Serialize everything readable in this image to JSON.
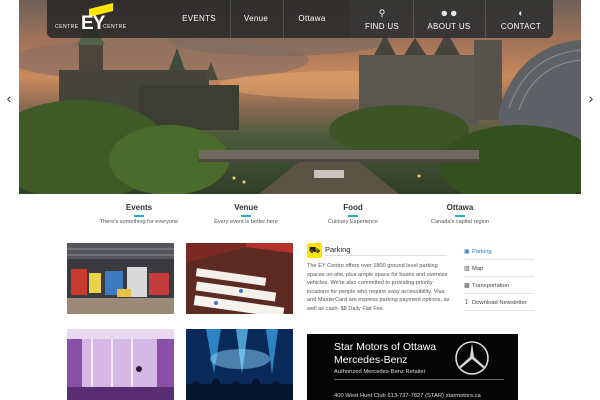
{
  "logo": {
    "brand": "EY",
    "left_word": "CENTRE",
    "right_word": "CENTRE"
  },
  "nav": {
    "links": [
      "EVENTS",
      "Venue",
      "Ottawa"
    ],
    "icon_links": [
      {
        "label": "FIND US",
        "icon": "map-pin-icon"
      },
      {
        "label": "ABOUT US",
        "icon": "people-icon"
      },
      {
        "label": "CONTACT",
        "icon": "contact-icon"
      }
    ]
  },
  "hero": {
    "prev": "‹",
    "next": "›"
  },
  "categories": [
    {
      "title": "Events",
      "subtitle": "There's something for everyone"
    },
    {
      "title": "Venue",
      "subtitle": "Every event is better here"
    },
    {
      "title": "Food",
      "subtitle": "Culinary Experience"
    },
    {
      "title": "Ottawa",
      "subtitle": "Canada's capital region"
    }
  ],
  "parking": {
    "title": "Parking",
    "text": "The EY Centre offers over 1800 ground level parking spaces on-site, plus ample space for buses and oversize vehicles. We're also committed to providing priority locations for people who require easy accessibility. Visa and MasterCard are express parking payment options, as well as cash. $8 Daily Flat Fee."
  },
  "side_links": [
    {
      "label": "Parking",
      "icon": "parking-icon",
      "active": true
    },
    {
      "label": "Map",
      "icon": "map-icon",
      "active": false
    },
    {
      "label": "Transportation",
      "icon": "bus-icon",
      "active": false
    },
    {
      "label": "Download Newsletter",
      "icon": "download-icon",
      "active": false
    }
  ],
  "ad": {
    "line1": "Star Motors of Ottawa",
    "line2": "Mercedes-Benz",
    "line3": "Authorized Mercedes-Benz Retailer",
    "line4": "400 West Hunt Club   613-737-7827 (STAR)   starmotors.ca"
  },
  "colors": {
    "accent": "#2da8d8",
    "ey_yellow": "#ffe600",
    "nav_bg": "#282828"
  }
}
